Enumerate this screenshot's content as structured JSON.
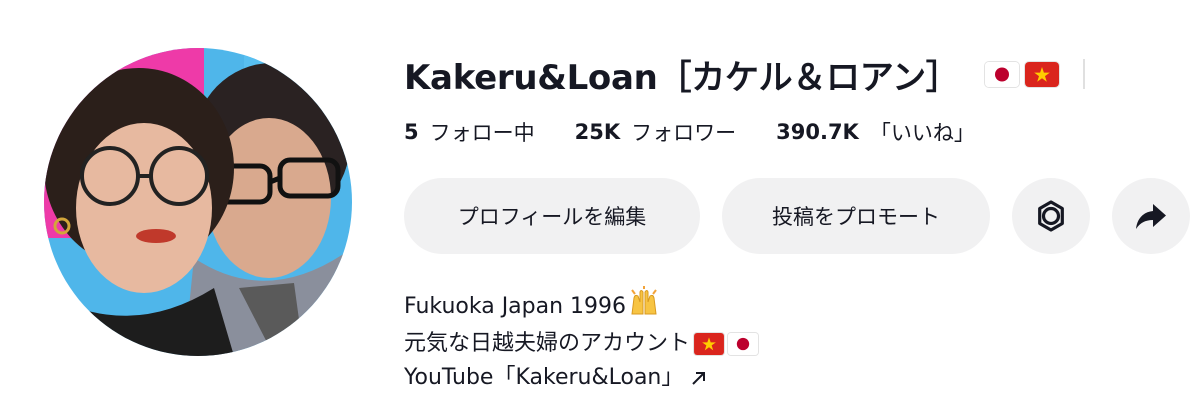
{
  "profile": {
    "display_name": "Kakeru&Loan［カケル＆ロアン］",
    "flags": [
      "japan-flag",
      "vietnam-flag"
    ]
  },
  "stats": [
    {
      "count": "5",
      "label": "フォロー中"
    },
    {
      "count": "25K",
      "label": "フォロワー"
    },
    {
      "count": "390.7K",
      "label": "「いいね」"
    }
  ],
  "actions": {
    "edit_profile": "プロフィールを編集",
    "promote_post": "投稿をプロモート",
    "settings_icon": "gear-icon",
    "share_icon": "share-arrow-icon"
  },
  "bio": {
    "line1": "Fukuoka Japan 1996",
    "line1_emoji": "raising-hands-emoji",
    "line2": "元気な日越夫婦のアカウント",
    "line2_flags": [
      "vietnam-flag",
      "japan-flag"
    ],
    "link_text": "YouTube「Kakeru&Loan」",
    "link_icon": "external-arrow-icon"
  },
  "colors": {
    "text": "#161823",
    "button_bg": "#f1f1f2",
    "avatar_bg_pink": "#ee3aa8",
    "avatar_bg_blue": "#4fb6ea"
  }
}
